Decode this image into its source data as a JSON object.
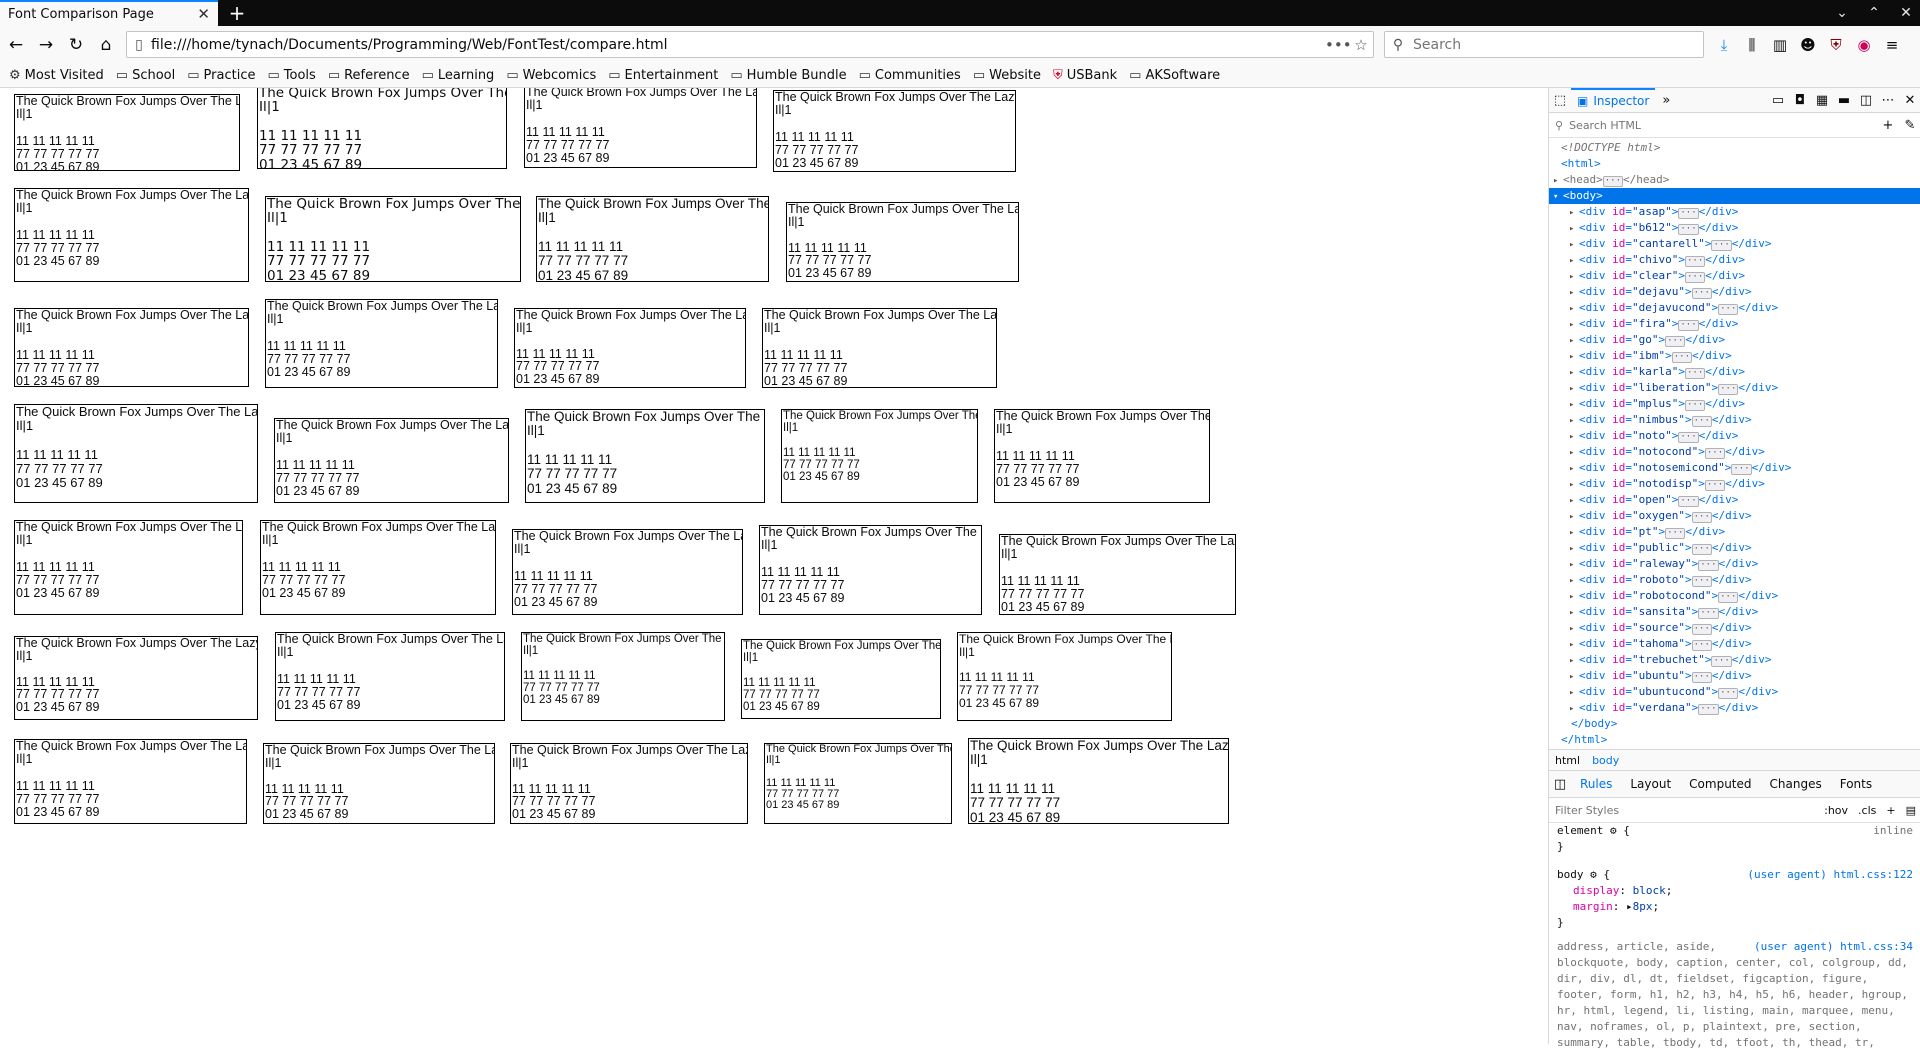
{
  "tab": {
    "title": "Font Comparison Page"
  },
  "window": {
    "controls": [
      "⌄",
      "⌃",
      "✕"
    ]
  },
  "nav": {
    "url": "file:///home/tynach/Documents/Programming/Web/FontTest/compare.html",
    "search_placeholder": "Search",
    "page_actions": "•••"
  },
  "bookmarks": [
    {
      "label": "Most Visited",
      "icon": "gear-icon"
    },
    {
      "label": "School",
      "icon": "folder-icon"
    },
    {
      "label": "Practice",
      "icon": "folder-icon"
    },
    {
      "label": "Tools",
      "icon": "folder-icon"
    },
    {
      "label": "Reference",
      "icon": "folder-icon"
    },
    {
      "label": "Learning",
      "icon": "folder-icon"
    },
    {
      "label": "Webcomics",
      "icon": "folder-icon"
    },
    {
      "label": "Entertainment",
      "icon": "folder-icon"
    },
    {
      "label": "Humble Bundle",
      "icon": "folder-icon"
    },
    {
      "label": "Communities",
      "icon": "folder-icon"
    },
    {
      "label": "Website",
      "icon": "folder-icon"
    },
    {
      "label": "USBank",
      "icon": "shield-icon"
    },
    {
      "label": "AKSoftware",
      "icon": "folder-icon"
    }
  ],
  "sample": {
    "title": "The Quick Brown Fox Jumps Over The Lazy Dog",
    "glyphs": "Il|1",
    "ones": "11 11 11 11 11",
    "sevens": "77 77 77 77 77",
    "digits": "01 23 45 67 89"
  },
  "devtools": {
    "inspector_label": "Inspector",
    "search_placeholder": "Search HTML",
    "doctype": "<!DOCTYPE html>",
    "html_tag": "html",
    "head_tag": "head",
    "body_tag": "body",
    "div_ids": [
      "asap",
      "b612",
      "cantarell",
      "chivo",
      "clear",
      "dejavu",
      "dejavucond",
      "fira",
      "go",
      "ibm",
      "karla",
      "liberation",
      "mplus",
      "nimbus",
      "noto",
      "notocond",
      "notosemicond",
      "notodisp",
      "open",
      "oxygen",
      "pt",
      "public",
      "raleway",
      "roboto",
      "robotocond",
      "sansita",
      "source",
      "tahoma",
      "trebuchet",
      "ubuntu",
      "ubuntucond",
      "verdana"
    ],
    "breadcrumbs": [
      "html",
      "body"
    ],
    "rule_tabs": [
      "Rules",
      "Layout",
      "Computed",
      "Changes",
      "Fonts"
    ],
    "filter_placeholder": "Filter Styles",
    "hov": ":hov",
    "cls": ".cls",
    "element_rule": {
      "selector": "element",
      "source": "inline"
    },
    "body_rule": {
      "selector": "body",
      "source": "(user agent) html.css:122",
      "props": [
        [
          "display",
          "block"
        ],
        [
          "margin",
          "8px"
        ]
      ]
    },
    "ua_rule_source": "(user agent) html.css:34",
    "ua_selectors": "address, article, aside, blockquote, body, caption, center, col, colgroup, dd, dir, div, dl, dt, fieldset, figcaption, figure, footer, form, h1, h2, h3, h4, h5, h6, header, hgroup, hr, html, legend, li, listing, main, marquee, menu, nav, noframes, ol, p, plaintext, pre, section, summary, table, tbody, td, tfoot, th, thead, tr,"
  }
}
